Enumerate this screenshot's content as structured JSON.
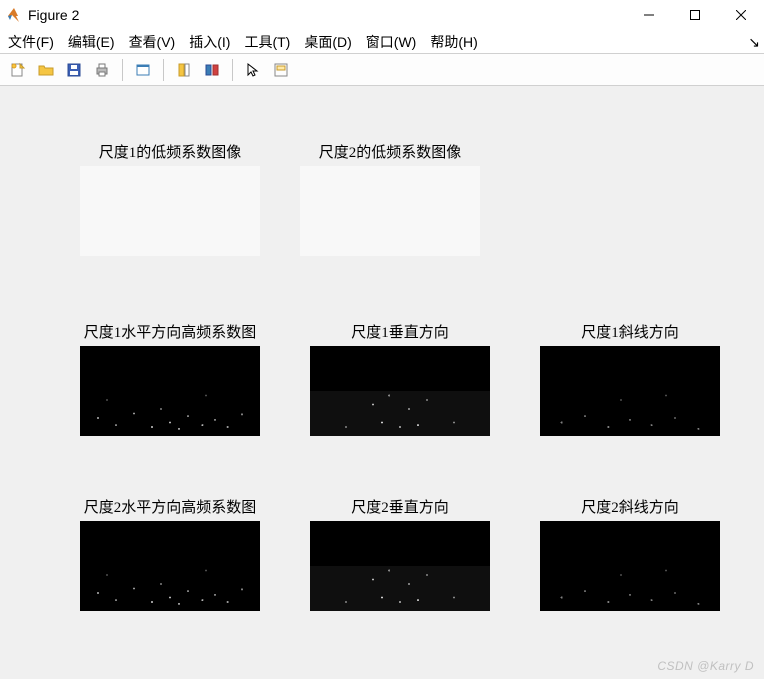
{
  "window": {
    "title": "Figure 2"
  },
  "menu": {
    "items": [
      "文件(F)",
      "编辑(E)",
      "查看(V)",
      "插入(I)",
      "工具(T)",
      "桌面(D)",
      "窗口(W)",
      "帮助(H)"
    ]
  },
  "toolbar": {
    "icons": [
      "new-figure-icon",
      "open-icon",
      "save-icon",
      "print-icon",
      "copy-icon",
      "link-axes-icon",
      "colorbar-icon",
      "cursor-icon",
      "data-cursor-icon"
    ]
  },
  "subplots": {
    "r1c1": {
      "title": "尺度1的低频系数图像"
    },
    "r1c2": {
      "title": "尺度2的低频系数图像"
    },
    "r2c1": {
      "title": "尺度1水平方向高频系数图"
    },
    "r2c2": {
      "title": "尺度1垂直方向"
    },
    "r2c3": {
      "title": "尺度1斜线方向"
    },
    "r3c1": {
      "title": "尺度2水平方向高频系数图"
    },
    "r3c2": {
      "title": "尺度2垂直方向"
    },
    "r3c3": {
      "title": "尺度2斜线方向"
    }
  },
  "watermark": "CSDN @Karry D"
}
